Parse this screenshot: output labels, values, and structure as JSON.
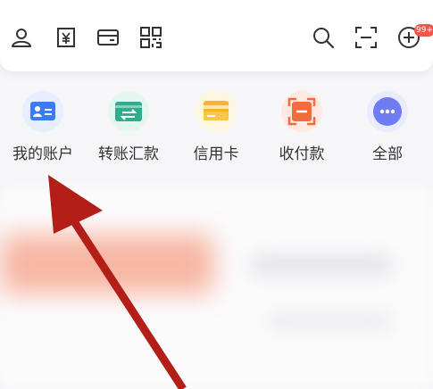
{
  "header": {
    "icons": [
      "user-icon",
      "bill-icon",
      "card-icon",
      "qr-code-icon",
      "search-icon",
      "scan-icon",
      "add-icon"
    ],
    "badge": "99+"
  },
  "quick_actions": [
    {
      "label": "我的账户",
      "icon": "account-card-icon",
      "color": "#3a7df0"
    },
    {
      "label": "转账汇款",
      "icon": "transfer-icon",
      "color": "#2fae8e"
    },
    {
      "label": "信用卡",
      "icon": "credit-card-icon",
      "color": "#f6b32e"
    },
    {
      "label": "收付款",
      "icon": "receive-pay-icon",
      "color": "#f26b3a"
    },
    {
      "label": "全部",
      "icon": "more-icon",
      "color": "#6f7cf2"
    }
  ],
  "colors": {
    "arrow": "#b31f18",
    "badge": "#f0584b",
    "background": "#f6f6f8"
  }
}
